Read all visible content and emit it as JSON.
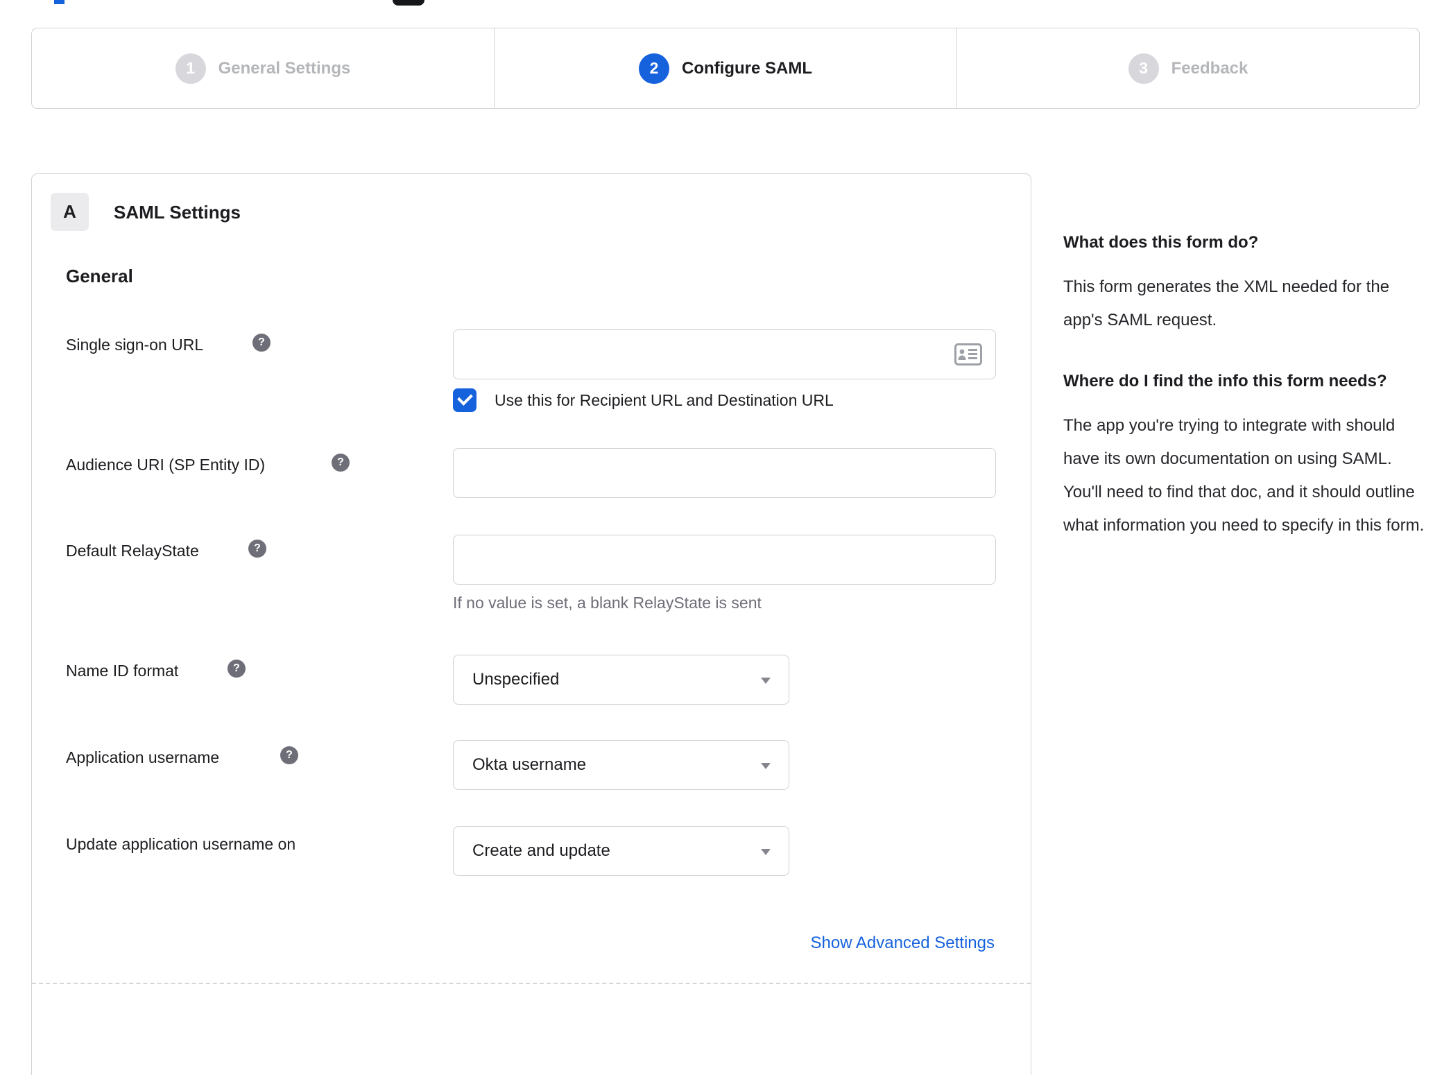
{
  "icons": {
    "help": "?"
  },
  "colors": {
    "accent_blue": "#1662dd",
    "inactive_gray": "#b4b6ba",
    "help_icon_gray": "#6e6e78",
    "border_gray": "#d3d3d8"
  },
  "stepper": {
    "steps": [
      {
        "number": "1",
        "label": "General Settings",
        "state": "inactive"
      },
      {
        "number": "2",
        "label": "Configure SAML",
        "state": "active"
      },
      {
        "number": "3",
        "label": "Feedback",
        "state": "inactive"
      }
    ]
  },
  "form": {
    "section_badge": "A",
    "section_title": "SAML Settings",
    "group_title": "General",
    "sso": {
      "label": "Single sign-on URL",
      "value": "",
      "checkbox_label": "Use this for Recipient URL and Destination URL",
      "checkbox_checked": true
    },
    "audience": {
      "label": "Audience URI (SP Entity ID)",
      "value": ""
    },
    "relay": {
      "label": "Default RelayState",
      "value": "",
      "hint": "If no value is set, a blank RelayState is sent"
    },
    "name_id": {
      "label": "Name ID format",
      "value": "Unspecified"
    },
    "app_username": {
      "label": "Application username",
      "value": "Okta username"
    },
    "update_on": {
      "label": "Update application username on",
      "value": "Create and update"
    },
    "advanced_link": "Show Advanced Settings"
  },
  "sidebar": {
    "sections": [
      {
        "heading": "What does this form do?",
        "body": "This form generates the XML needed for the app's SAML request."
      },
      {
        "heading": "Where do I find the info this form needs?",
        "body": "The app you're trying to integrate with should have its own documentation on using SAML. You'll need to find that doc, and it should outline what information you need to specify in this form."
      }
    ]
  }
}
